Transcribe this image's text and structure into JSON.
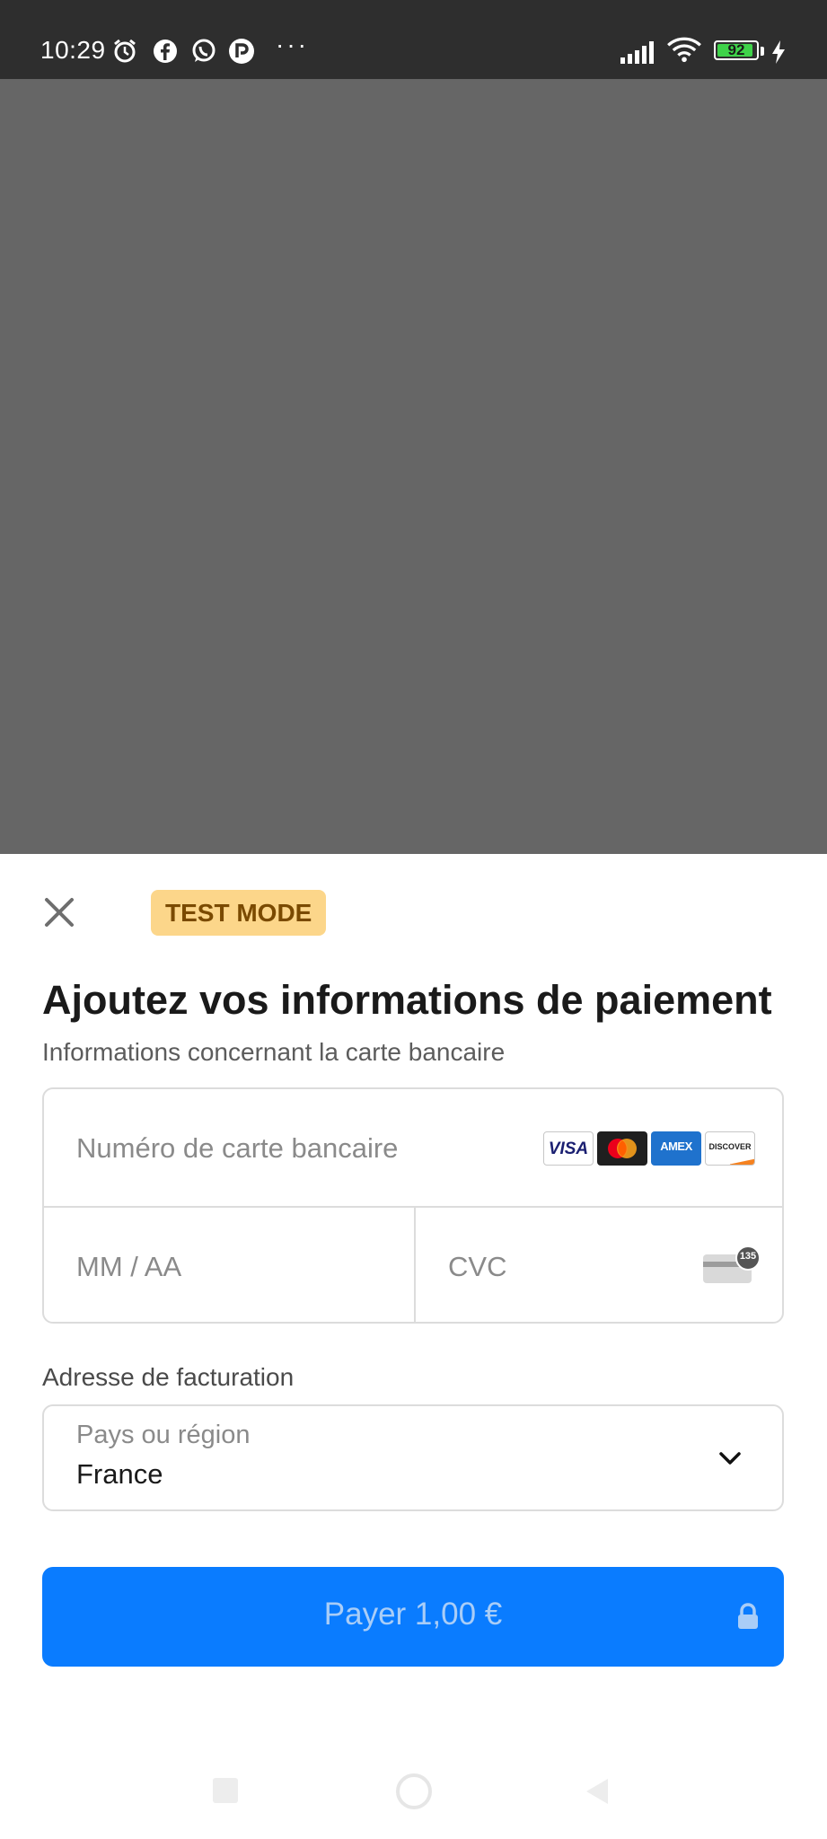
{
  "status_bar": {
    "time": "10:29",
    "overflow": "···",
    "battery_level": "92",
    "battery_fraction": 0.92,
    "icons": [
      "alarm-icon",
      "facebook-icon",
      "whatsapp-icon",
      "app-icon",
      "signal-icon",
      "wifi-icon",
      "battery-icon",
      "charging-icon"
    ]
  },
  "sheet": {
    "badge": "TEST MODE",
    "title": "Ajoutez vos informations de paiement",
    "subtitle": "Informations concernant la carte bancaire",
    "card": {
      "number_placeholder": "Numéro de carte bancaire",
      "expiry_placeholder": "MM / AA",
      "cvc_placeholder": "CVC",
      "brands": [
        "VISA",
        "Mastercard",
        "AMEX",
        "DISCOVER"
      ],
      "cvc_hint": "135"
    },
    "billing": {
      "label": "Adresse de facturation",
      "country_label": "Pays ou région",
      "country_value": "France"
    },
    "pay_button": "Payer 1,00 €"
  },
  "colors": {
    "accent": "#0a7cff",
    "badge_bg": "#fcd68a",
    "badge_text": "#7a4a00",
    "backdrop": "#666666",
    "status_bar": "#2e2e2e"
  }
}
